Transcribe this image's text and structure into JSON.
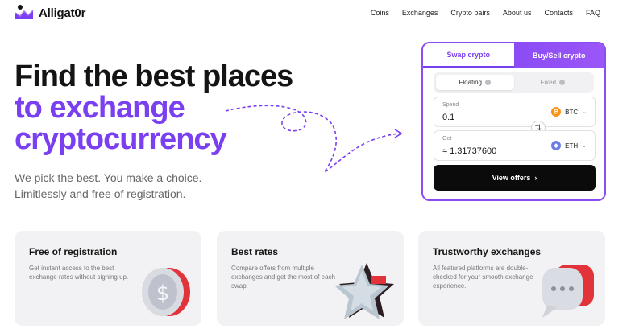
{
  "brand": {
    "name": "Alligat0r"
  },
  "nav": {
    "items": [
      "Coins",
      "Exchanges",
      "Crypto pairs",
      "About us",
      "Contacts",
      "FAQ"
    ]
  },
  "hero": {
    "line1": "Find the best places",
    "line2": "to exchange",
    "line3": "cryptocurrency",
    "sub1": "We pick the best. You make a choice.",
    "sub2": "Limitlessly and free of registration."
  },
  "widget": {
    "tabs": [
      "Swap crypto",
      "Buy/Sell crypto"
    ],
    "active_tab": "Swap crypto",
    "rate_types": [
      "Floating",
      "Fixed"
    ],
    "active_rate": "Floating",
    "spend": {
      "label": "Spend",
      "value": "0.1",
      "coin": "BTC"
    },
    "get": {
      "label": "Get",
      "value": "≈ 1.31737600",
      "coin": "ETH"
    },
    "cta": "View offers",
    "colors": {
      "accent": "#8b4cf5",
      "button": "#0b0b0b"
    }
  },
  "features": [
    {
      "title": "Free of registration",
      "desc": "Get instant access to the best exchange rates without signing up.",
      "icon": "coin-icon"
    },
    {
      "title": "Best rates",
      "desc": "Compare offers from multiple exchanges and get the most of each swap.",
      "icon": "star-icon"
    },
    {
      "title": "Trustworthy exchanges",
      "desc": "All featured platforms are double-checked for your smooth exchange experience.",
      "icon": "chat-bubble-icon"
    }
  ]
}
